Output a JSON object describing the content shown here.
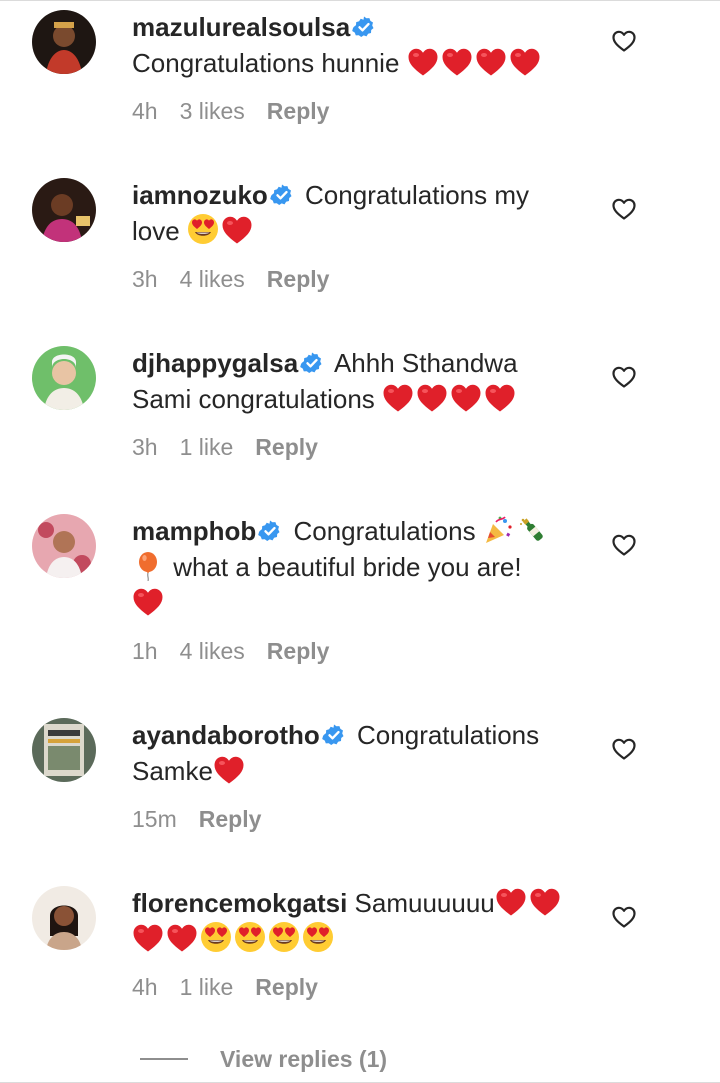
{
  "comments": [
    {
      "username": "mazulurealsoulsa",
      "text": "Congratulations hunnie",
      "emojis": [
        "red-heart",
        "red-heart",
        "red-heart",
        "red-heart"
      ],
      "time": "4h",
      "likes": "3 likes",
      "reply": "Reply",
      "avatar_color": "#3a2a1f"
    },
    {
      "username": "iamnozuko",
      "text_line1": "Congratulations my",
      "text_line2": "love",
      "emojis": [
        "heart-eyes",
        "red-heart"
      ],
      "time": "3h",
      "likes": "4 likes",
      "reply": "Reply",
      "avatar_color": "#5a3a2e"
    },
    {
      "username": "djhappygalsa",
      "text_line1": "Ahhh Sthandwa",
      "text_line2": "Sami congratulations",
      "emojis": [
        "red-heart",
        "red-heart",
        "red-heart",
        "red-heart"
      ],
      "time": "3h",
      "likes": "1 like",
      "reply": "Reply",
      "avatar_color": "#7bc47a"
    },
    {
      "username": "mamphob",
      "text_line1": "Congratulations",
      "text_line2": "what a beautiful bride you are!",
      "emojis": [
        "party-popper",
        "champagne",
        "balloon",
        "red-heart"
      ],
      "time": "1h",
      "likes": "4 likes",
      "reply": "Reply",
      "avatar_color": "#d88a96"
    },
    {
      "username": "ayandaborotho",
      "text_line1": "Congratulations",
      "text_line2": "Samke",
      "emojis": [
        "red-heart"
      ],
      "time": "15m",
      "reply": "Reply",
      "avatar_color": "#4a5648"
    },
    {
      "username": "florencemokgatsi",
      "text": "Samuuuuuu",
      "emojis": [
        "red-heart",
        "red-heart",
        "red-heart",
        "red-heart",
        "heart-eyes",
        "heart-eyes",
        "heart-eyes",
        "heart-eyes"
      ],
      "time": "4h",
      "likes": "1 like",
      "reply": "Reply",
      "avatar_color": "#c9a58a"
    }
  ],
  "view_replies": "View replies (1)",
  "colors": {
    "text": "#262626",
    "secondary": "#8e8e8e",
    "verified": "#3897f0",
    "heart": "#e0202a"
  },
  "icons": {
    "like": "heart-outline-icon",
    "verified": "verified-badge-icon"
  }
}
